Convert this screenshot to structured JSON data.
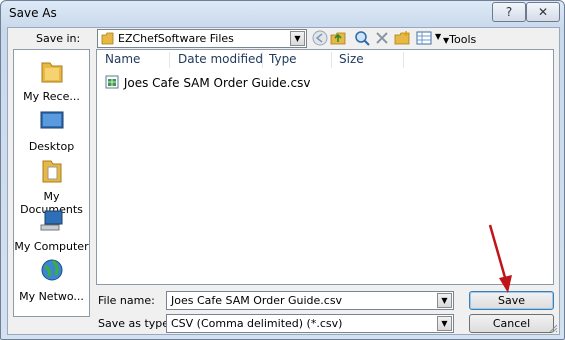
{
  "window": {
    "title": "Save As"
  },
  "save_in": {
    "label": "Save in:",
    "value": "EZChefSoftware Files"
  },
  "toolbar": {
    "tools_label": "Tools"
  },
  "places": [
    {
      "label": "My Rece...",
      "icon": "recent-folder-icon"
    },
    {
      "label": "Desktop",
      "icon": "desktop-icon"
    },
    {
      "label": "My Documents",
      "icon": "documents-folder-icon"
    },
    {
      "label": "My Computer",
      "icon": "computer-icon"
    },
    {
      "label": "My Netwo...",
      "icon": "network-globe-icon"
    }
  ],
  "file_list": {
    "columns": [
      "Name",
      "Date modified",
      "Type",
      "Size"
    ],
    "files": [
      {
        "name": "Joes Cafe SAM Order Guide.csv",
        "icon": "csv-file-icon"
      }
    ]
  },
  "file_name": {
    "label": "File name:",
    "value": "Joes Cafe SAM Order Guide.csv"
  },
  "save_as_type": {
    "label": "Save as type:",
    "value": "CSV (Comma delimited) (*.csv)"
  },
  "buttons": {
    "save": "Save",
    "cancel": "Cancel"
  },
  "colors": {
    "arrow": "#c0141b",
    "folder": "#e8b844",
    "accent": "#3c7fb1"
  }
}
